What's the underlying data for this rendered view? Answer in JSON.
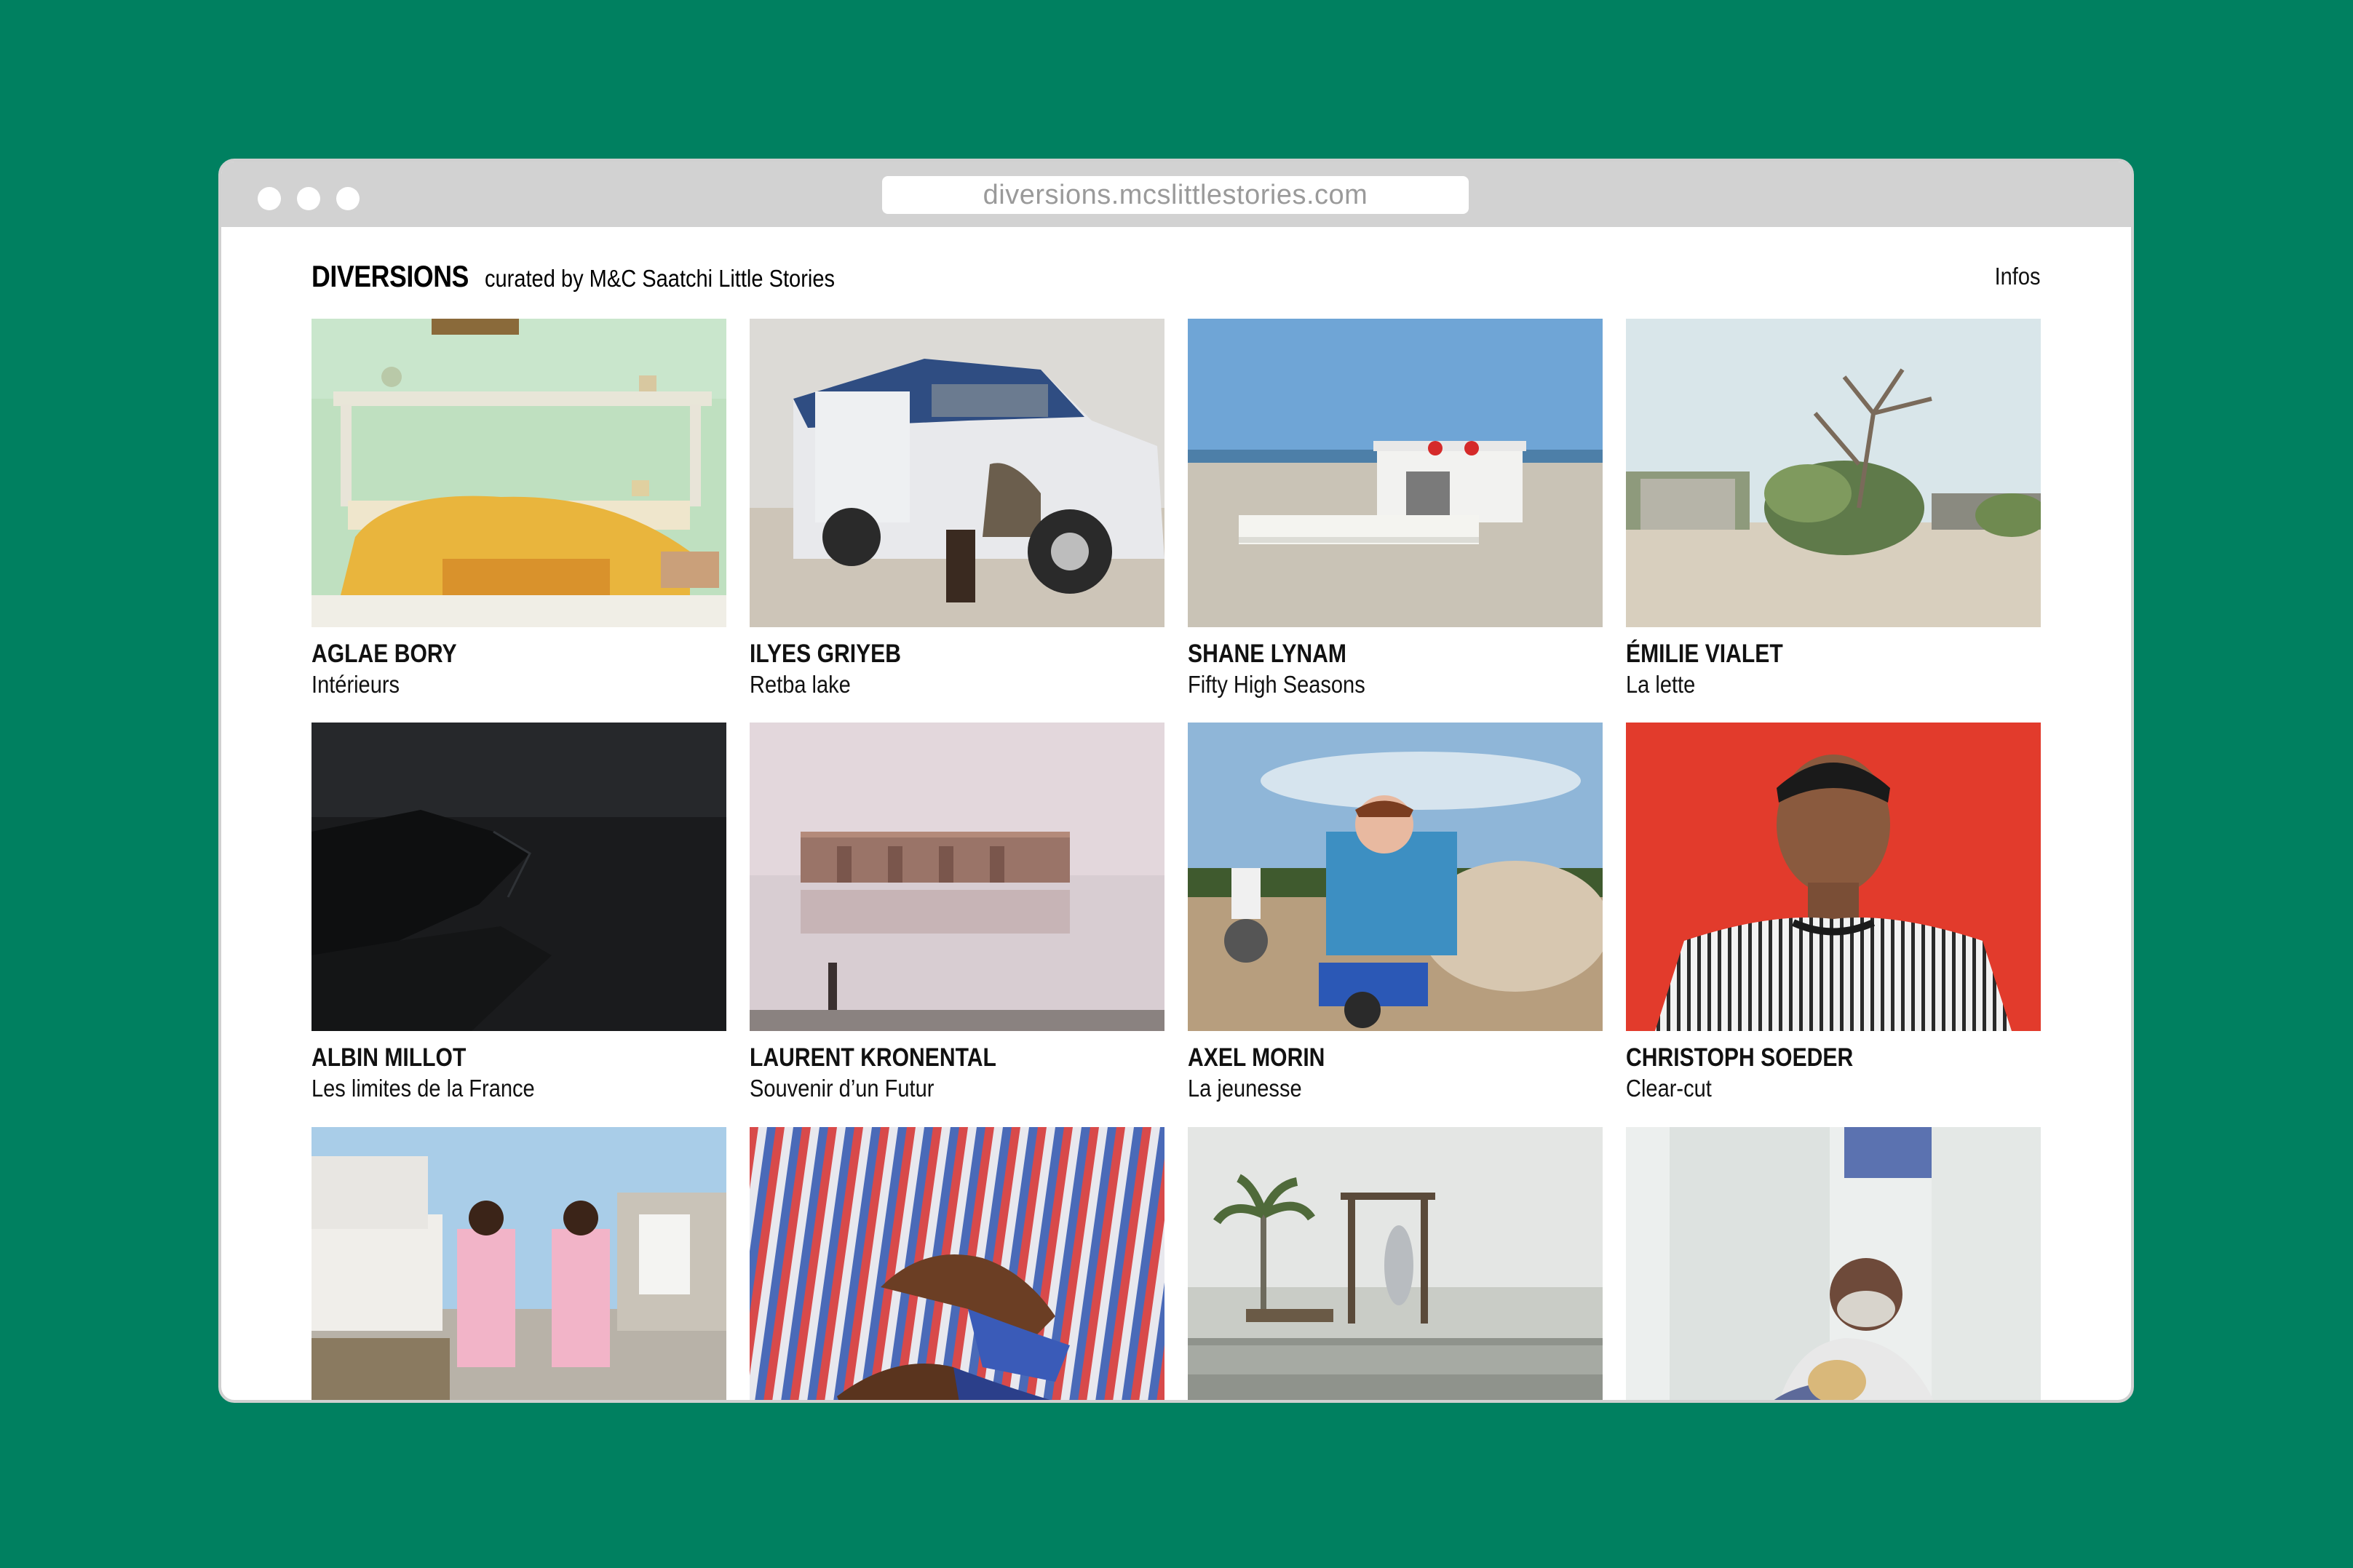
{
  "browser": {
    "url": "diversions.mcslittlestories.com"
  },
  "header": {
    "logo": "DIVERSIONS",
    "tagline": "curated by M&C Saatchi Little Stories",
    "infos_link": "Infos"
  },
  "colors": {
    "background": "#008060",
    "chrome": "#d2d2d2"
  },
  "gallery": [
    {
      "artist": "AGLAE BORY",
      "title": "Intérieurs"
    },
    {
      "artist": "ILYES GRIYEB",
      "title": "Retba lake"
    },
    {
      "artist": "SHANE LYNAM",
      "title": "Fifty High Seasons"
    },
    {
      "artist": "ÉMILIE VIALET",
      "title": "La lette"
    },
    {
      "artist": "ALBIN MILLOT",
      "title": "Les limites de la France"
    },
    {
      "artist": "LAURENT KRONENTAL",
      "title": "Souvenir d’un Futur"
    },
    {
      "artist": "AXEL MORIN",
      "title": "La jeunesse"
    },
    {
      "artist": "CHRISTOPH SOEDER",
      "title": "Clear-cut"
    },
    {
      "artist": "",
      "title": ""
    },
    {
      "artist": "",
      "title": ""
    },
    {
      "artist": "",
      "title": ""
    },
    {
      "artist": "",
      "title": ""
    }
  ]
}
